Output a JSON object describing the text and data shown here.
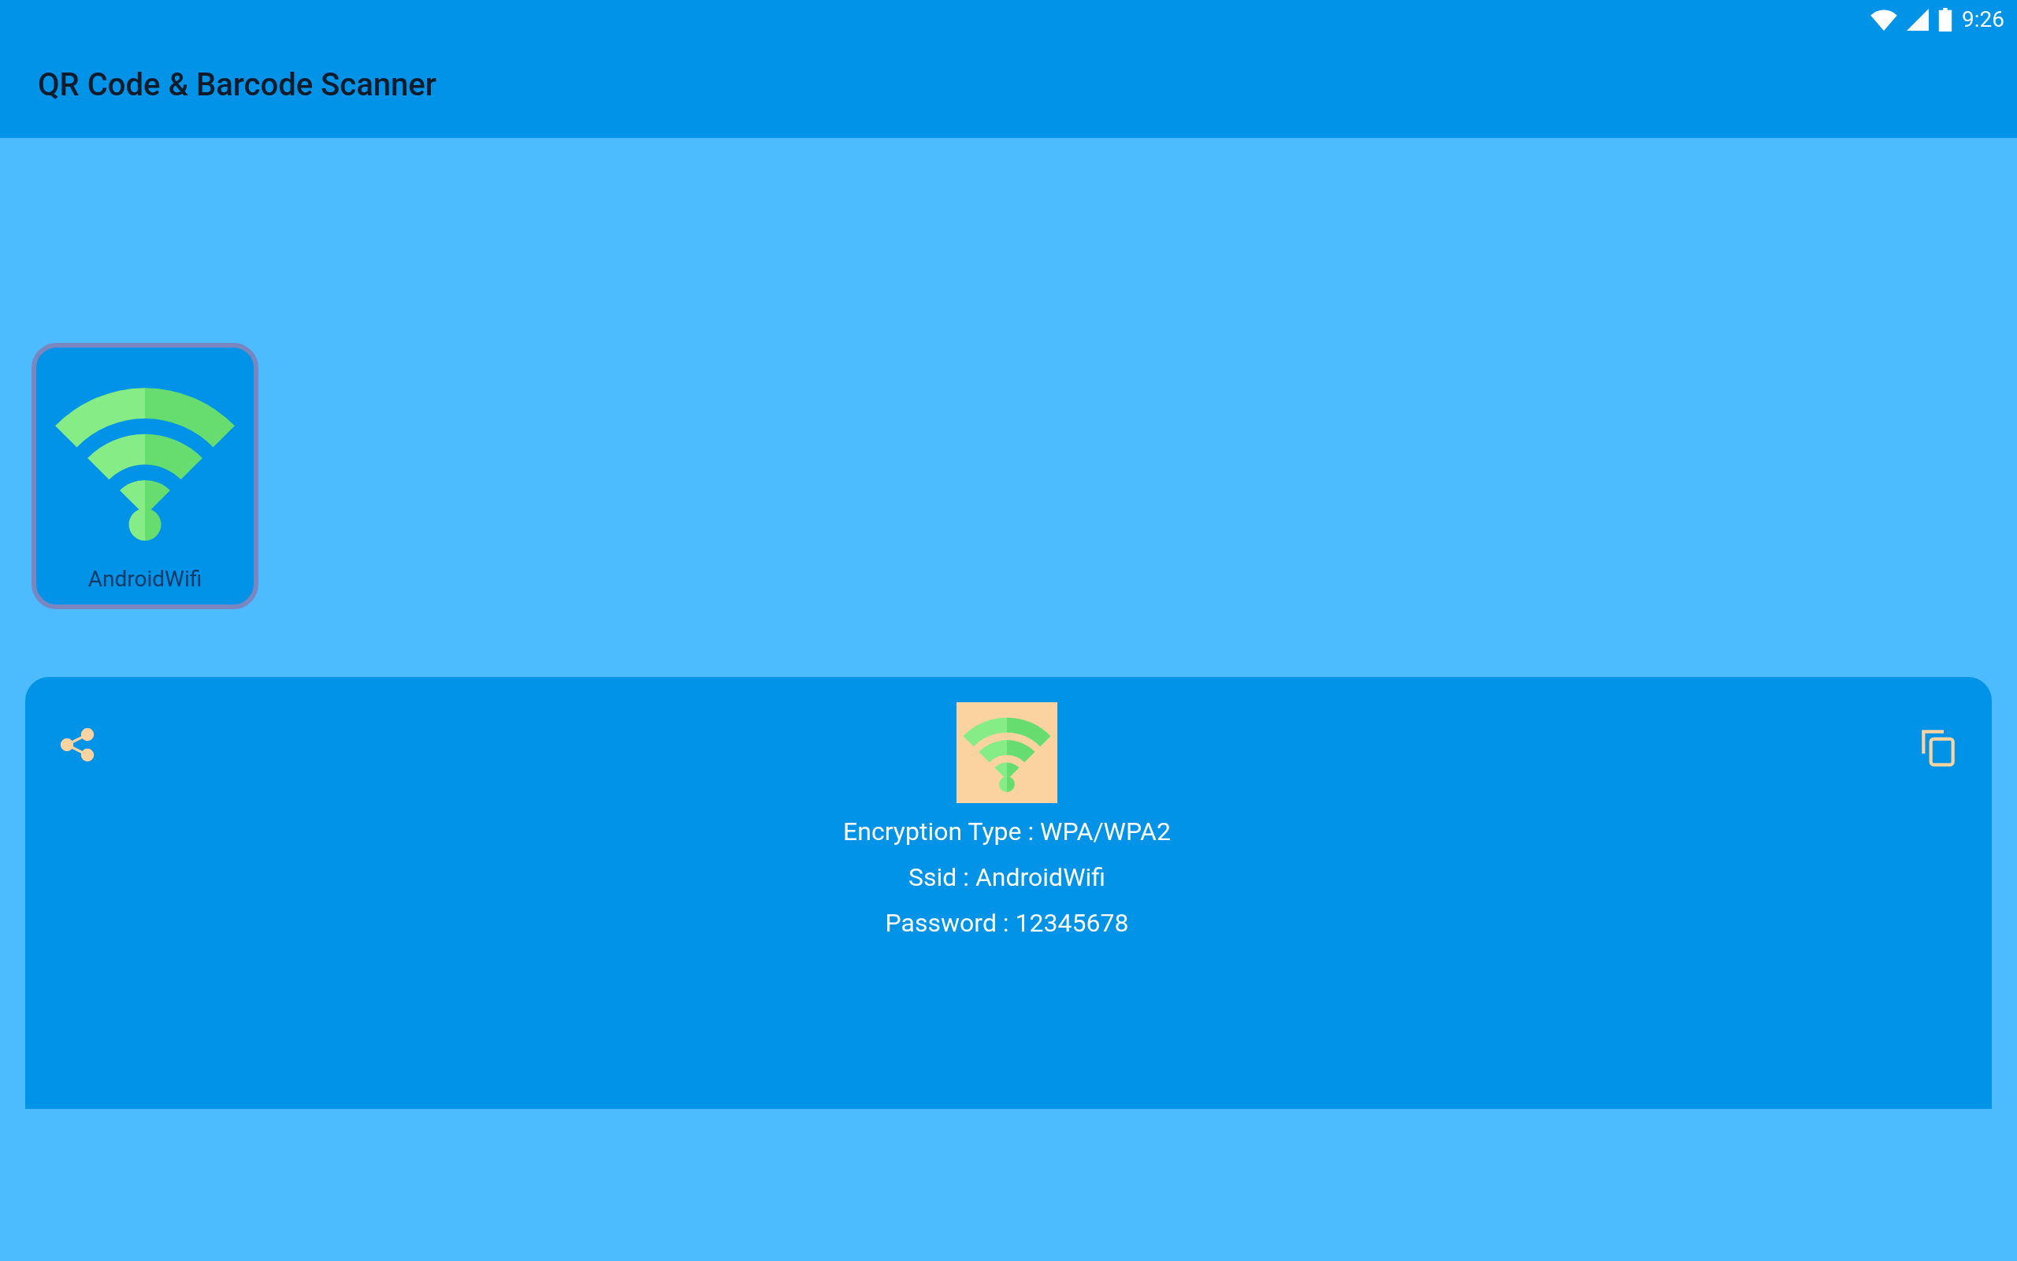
{
  "status_bar": {
    "time": "9:26"
  },
  "app_bar": {
    "title": "QR Code & Barcode Scanner"
  },
  "history": [
    {
      "label": "AndroidWifi",
      "selected": true
    }
  ],
  "result": {
    "lines": [
      "Encryption Type : WPA/WPA2",
      "Ssid : AndroidWifi",
      "Password : 12345678"
    ]
  }
}
